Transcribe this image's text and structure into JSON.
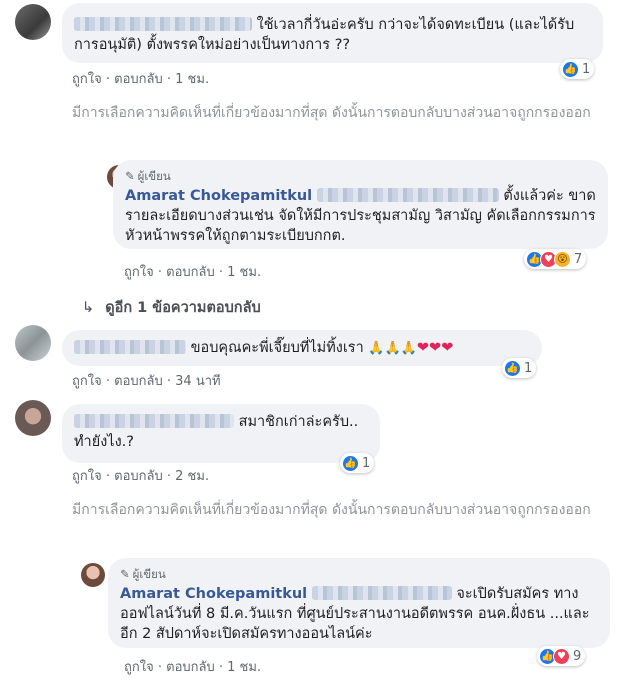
{
  "comments": [
    {
      "text": "ใช้เวลากี่วันอ่ะครับ กว่าจะได้จดทะเบียน (และได้รับการอนุมัติ) ตั้งพรรคใหม่อย่างเป็นทางการ ??",
      "like": "ถูกใจ",
      "reply": "ตอบกลับ",
      "time": "1 ชม.",
      "reactions": "1"
    },
    {
      "text": "ขอบคุณคะพี่เจี๊ยบที่ไม่ทิ้งเรา",
      "like": "ถูกใจ",
      "reply": "ตอบกลับ",
      "time": "34 นาที",
      "reactions": "1"
    },
    {
      "text": "สมาชิกเก่าล่ะครับ.. ทำยังไง.?",
      "like": "ถูกใจ",
      "reply": "ตอบกลับ",
      "time": "2 ชม.",
      "reactions": "1"
    }
  ],
  "replies": [
    {
      "tag": "ผู้เขียน",
      "name": "Amarat Chokepamitkul",
      "text": "ตั้งแล้วค่ะ ขาดรายละเอียดบางส่วนเช่น จัดให้มีการประชุมสามัญ วิสามัญ คัดเลือกกรรมการ หัวหน้าพรรคให้ถูกตามระเบียบกกต.",
      "like": "ถูกใจ",
      "reply": "ตอบกลับ",
      "time": "1 ชม.",
      "reactions": "7"
    },
    {
      "tag": "ผู้เขียน",
      "name": "Amarat Chokepamitkul",
      "text": "จะเปิดรับสมัคร ทางออฟไลน์วันที่ 8 มี.ค.วันแรก ที่ศูนย์ประสานงานอดีตพรรค อนค.ฝั่งธน ...และอีก 2 สัปดาห์จะเปิดสมัครทางออนไลน์ค่ะ",
      "like": "ถูกใจ",
      "reply": "ตอบกลับ",
      "time": "1 ชม.",
      "reactions": "9"
    }
  ],
  "filter_note": "มีการเลือกความคิดเห็นที่เกี่ยวข้องมากที่สุด ดังนั้นการตอบกลับบางส่วนอาจถูกกรองออก",
  "view_more": "ดูอีก 1 ข้อความตอบกลับ",
  "separator": "·",
  "colors": {
    "bubble": "#f0f2f5",
    "name": "#385898",
    "like": "#1877f2",
    "love": "#f33e58",
    "wow": "#f7b125"
  }
}
